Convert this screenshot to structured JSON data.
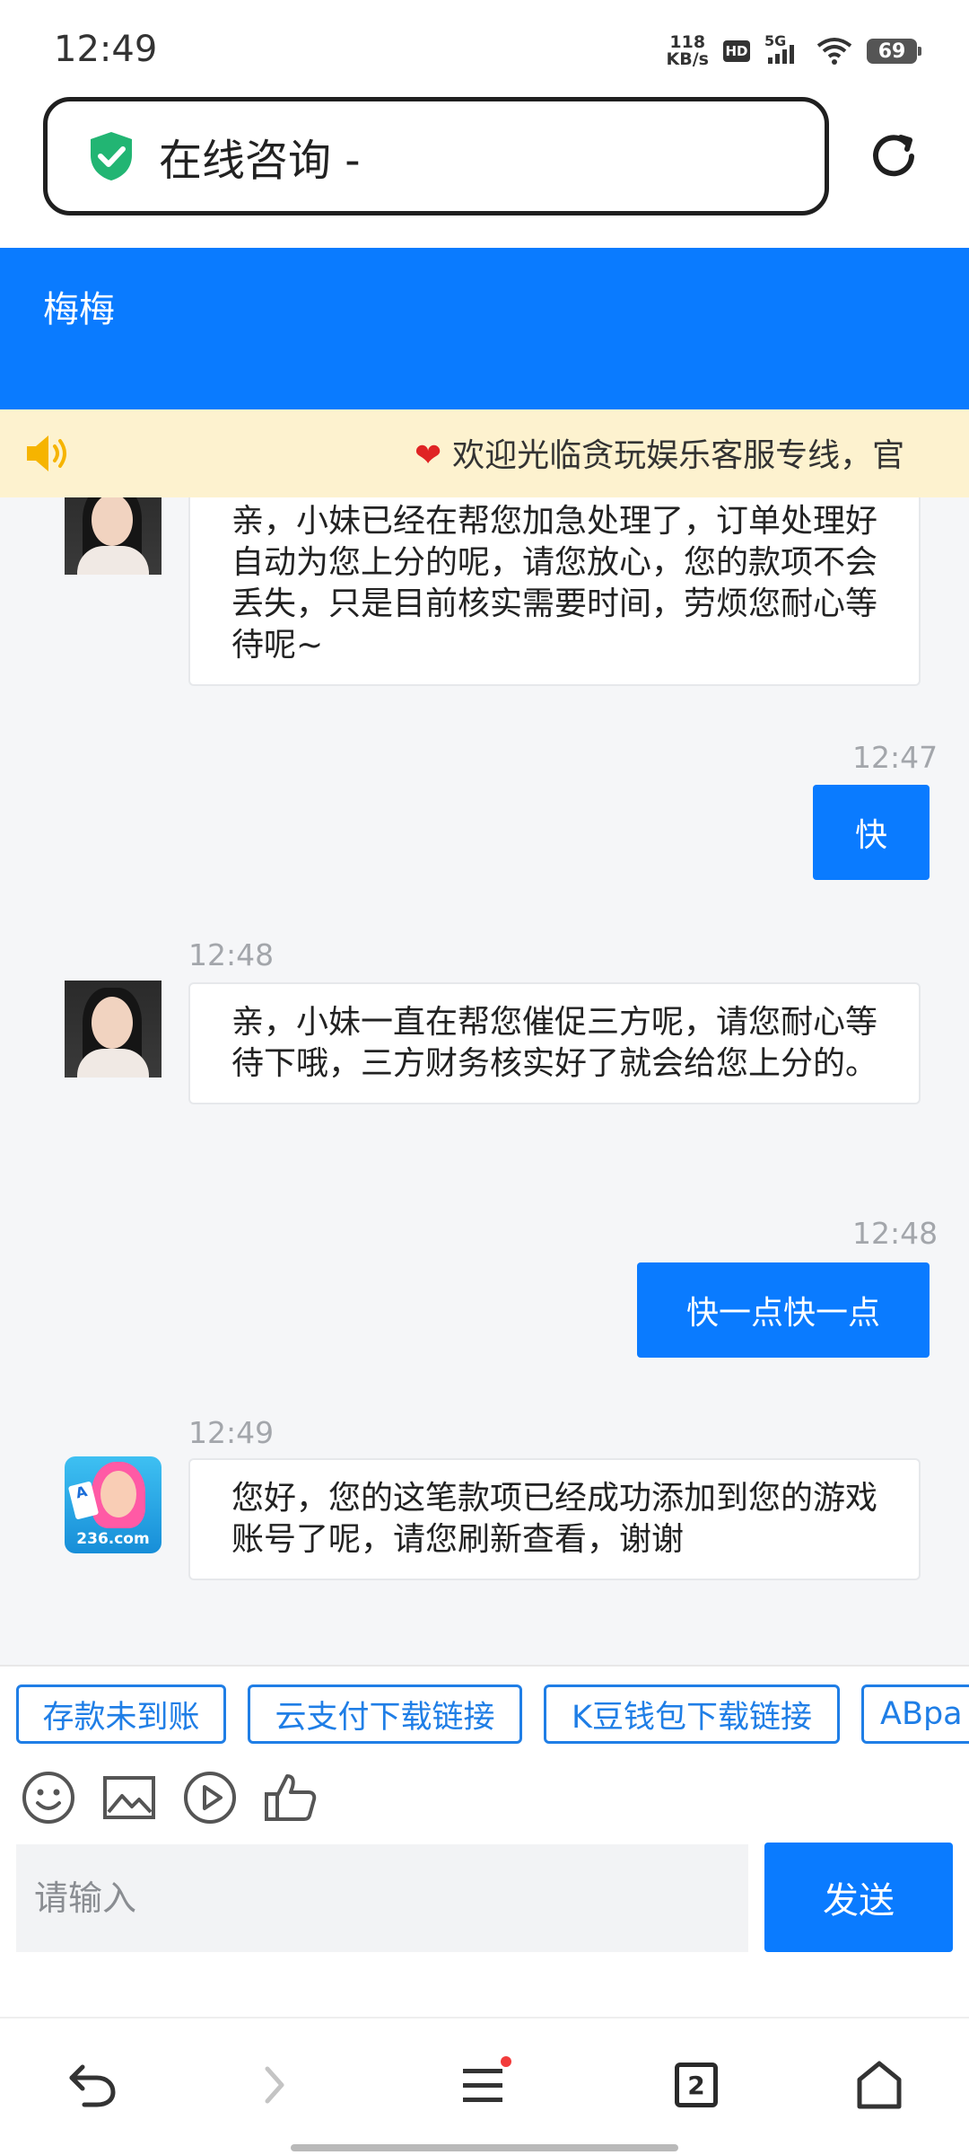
{
  "status_bar": {
    "time": "12:49",
    "net_speed_value": "118",
    "net_speed_unit": "KB/s",
    "hd_label": "HD",
    "signal_label": "5G",
    "battery": "69"
  },
  "browser": {
    "address_text": "在线咨询 -",
    "tabs_count": "2"
  },
  "chat": {
    "agent_name": "梅梅",
    "notice": "欢迎光临贪玩娱乐客服专线，官",
    "messages": [
      {
        "side": "left",
        "avatar": "agent-girl",
        "text": "亲，小妹已经在帮您加急处理了，订单处理好自动为您上分的呢，请您放心，您的款项不会丢失，只是目前核实需要时间，劳烦您耐心等待呢~"
      },
      {
        "side": "right",
        "time": "12:47",
        "text": "快"
      },
      {
        "side": "left",
        "time": "12:48",
        "avatar": "agent-girl",
        "text": "亲，小妹一直在帮您催促三方呢，请您耐心等待下哦，三方财务核实好了就会给您上分的。"
      },
      {
        "side": "right",
        "time": "12:48",
        "text": "快一点快一点"
      },
      {
        "side": "left",
        "time": "12:49",
        "avatar": "agent-game",
        "avatar_label": "236.com",
        "text": "您好，您的这笔款项已经成功添加到您的游戏账号了呢，请您刷新查看，谢谢"
      }
    ]
  },
  "quick_replies": [
    "存款未到账",
    "云支付下载链接",
    "K豆钱包下载链接",
    "ABpa"
  ],
  "toolbar": {
    "icons": [
      "emoji-icon",
      "image-icon",
      "video-icon",
      "thumbs-up-icon"
    ]
  },
  "composer": {
    "placeholder": "请输入",
    "send_label": "发送"
  },
  "colors": {
    "brand_blue": "#0a7bff",
    "notice_bg": "#fdf2cf",
    "chip_border": "#1f7ee6"
  }
}
